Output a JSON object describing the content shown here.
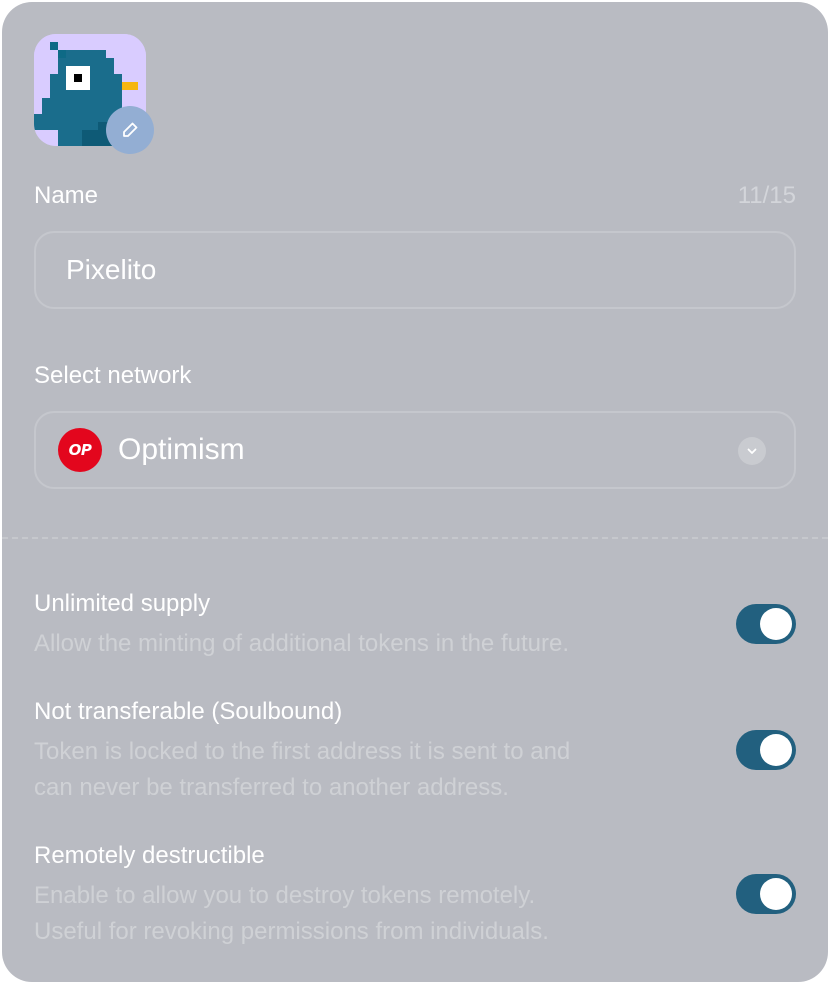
{
  "token_form": {
    "avatar": {
      "icon": "pixel-bird-icon",
      "edit_icon": "pencil-icon"
    },
    "name": {
      "label": "Name",
      "counter": "11/15",
      "value": "Pixelito"
    },
    "network": {
      "label": "Select network",
      "logo_text": "OP",
      "selected": "Optimism",
      "logo_color": "#e3061d",
      "chevron_icon": "chevron-down-icon"
    },
    "options": [
      {
        "title": "Unlimited supply",
        "description_lines": [
          "Allow the minting of additional tokens in the future."
        ],
        "enabled": true
      },
      {
        "title": "Not transferable (Soulbound)",
        "description_lines": [
          "Token is locked to the first address it is sent to and",
          "can never be transferred to another address."
        ],
        "enabled": true
      },
      {
        "title": "Remotely destructible",
        "description_lines": [
          "Enable to allow you to destroy tokens remotely.",
          "Useful for revoking permissions from individuals."
        ],
        "enabled": true
      }
    ],
    "colors": {
      "background": "#b9bbc2",
      "toggle_on": "#22607f",
      "avatar_bg": "#d9ccff",
      "edit_button": "#93aed3"
    }
  }
}
